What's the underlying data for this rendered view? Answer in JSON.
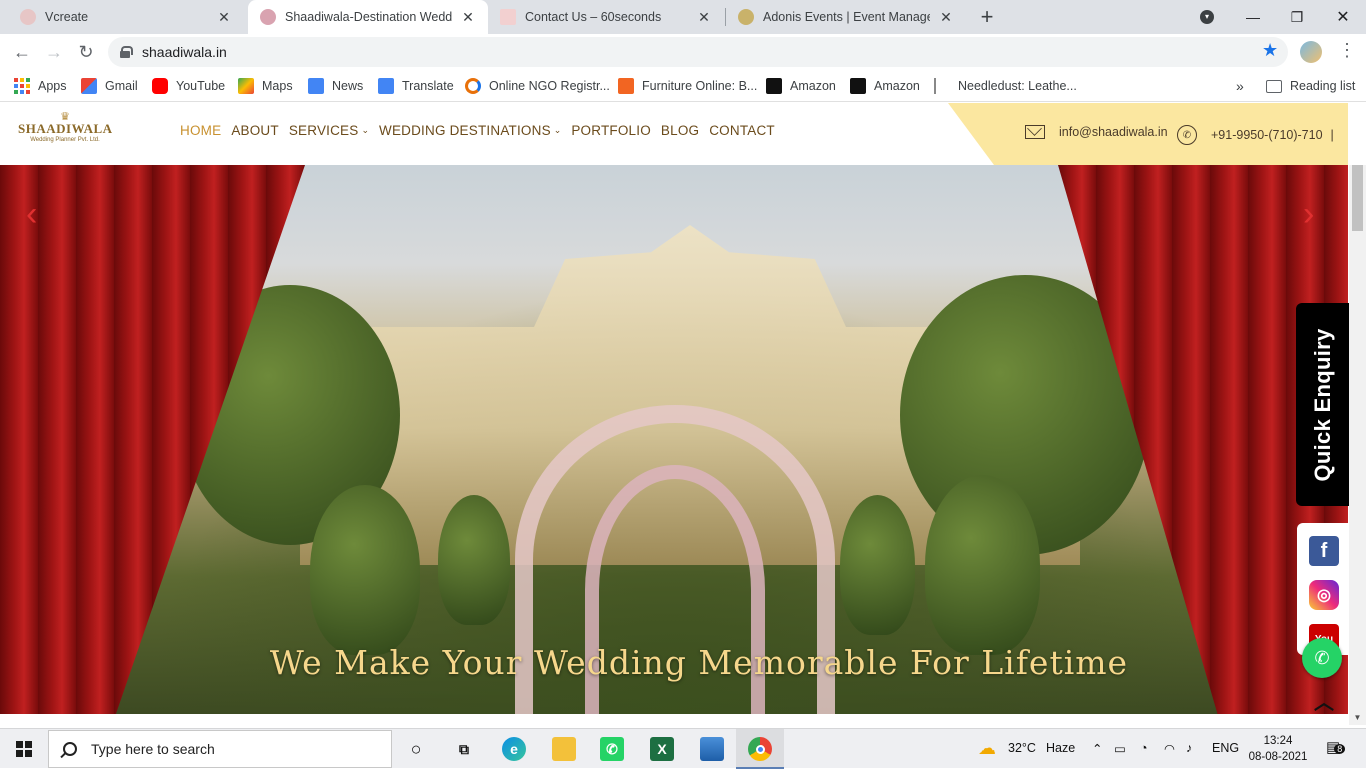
{
  "browser": {
    "tabs": [
      {
        "title": "Vcreate",
        "active": false
      },
      {
        "title": "Shaadiwala-Destination Wedding",
        "active": true
      },
      {
        "title": "Contact Us – 60seconds",
        "active": false
      },
      {
        "title": "Adonis Events | Event Manageme",
        "active": false
      }
    ],
    "url": "shaadiwala.in",
    "bookmarks": [
      {
        "label": "Apps",
        "icon": "apps-grid-icon"
      },
      {
        "label": "Gmail",
        "icon": "gmail-icon"
      },
      {
        "label": "YouTube",
        "icon": "youtube-icon"
      },
      {
        "label": "Maps",
        "icon": "maps-icon"
      },
      {
        "label": "News",
        "icon": "news-icon"
      },
      {
        "label": "Translate",
        "icon": "translate-icon"
      },
      {
        "label": "Online NGO Registr...",
        "icon": "ngo-icon"
      },
      {
        "label": "Furniture Online: B...",
        "icon": "ws-icon"
      },
      {
        "label": "Amazon",
        "icon": "amazon-icon"
      },
      {
        "label": "Amazon",
        "icon": "amazon-icon"
      },
      {
        "label": "Needledust: Leathe...",
        "icon": "needledust-icon"
      }
    ],
    "bookmarks_overflow": "»",
    "reading_list": "Reading list"
  },
  "site": {
    "logo": {
      "name": "SHAADIWALA",
      "sub": "Wedding Planner Pvt. Ltd."
    },
    "nav": [
      {
        "label": "HOME",
        "dropdown": false
      },
      {
        "label": "ABOUT",
        "dropdown": false
      },
      {
        "label": "SERVICES",
        "dropdown": true
      },
      {
        "label": "WEDDING DESTINATIONS",
        "dropdown": true
      },
      {
        "label": "PORTFOLIO",
        "dropdown": false
      },
      {
        "label": "BLOG",
        "dropdown": false
      },
      {
        "label": "CONTACT",
        "dropdown": false
      }
    ],
    "email": "info@shaadiwala.in",
    "phone": "+91-9950-(710)-710",
    "phone_sep": "|",
    "hero_heading": "We Make Your Wedding Memorable For Lifetime",
    "quick_enquiry": "Quick Enquiry",
    "social": [
      {
        "label": "f",
        "icon": "facebook-icon",
        "color": "#3b5998"
      },
      {
        "label": "◎",
        "icon": "instagram-icon",
        "color": "#e1306c"
      },
      {
        "label": "You",
        "icon": "youtube-icon",
        "color": "#cc0000"
      }
    ],
    "colors": {
      "accent": "#c8912f",
      "nav_text": "#6b4b1c",
      "band": "#fbe7a0",
      "heading": "#f6d78c"
    }
  },
  "taskbar": {
    "search_placeholder": "Type here to search",
    "weather_temp": "32°C",
    "weather_desc": "Haze",
    "lang": "ENG",
    "time": "13:24",
    "date": "08-08-2021",
    "notifications": "8"
  }
}
